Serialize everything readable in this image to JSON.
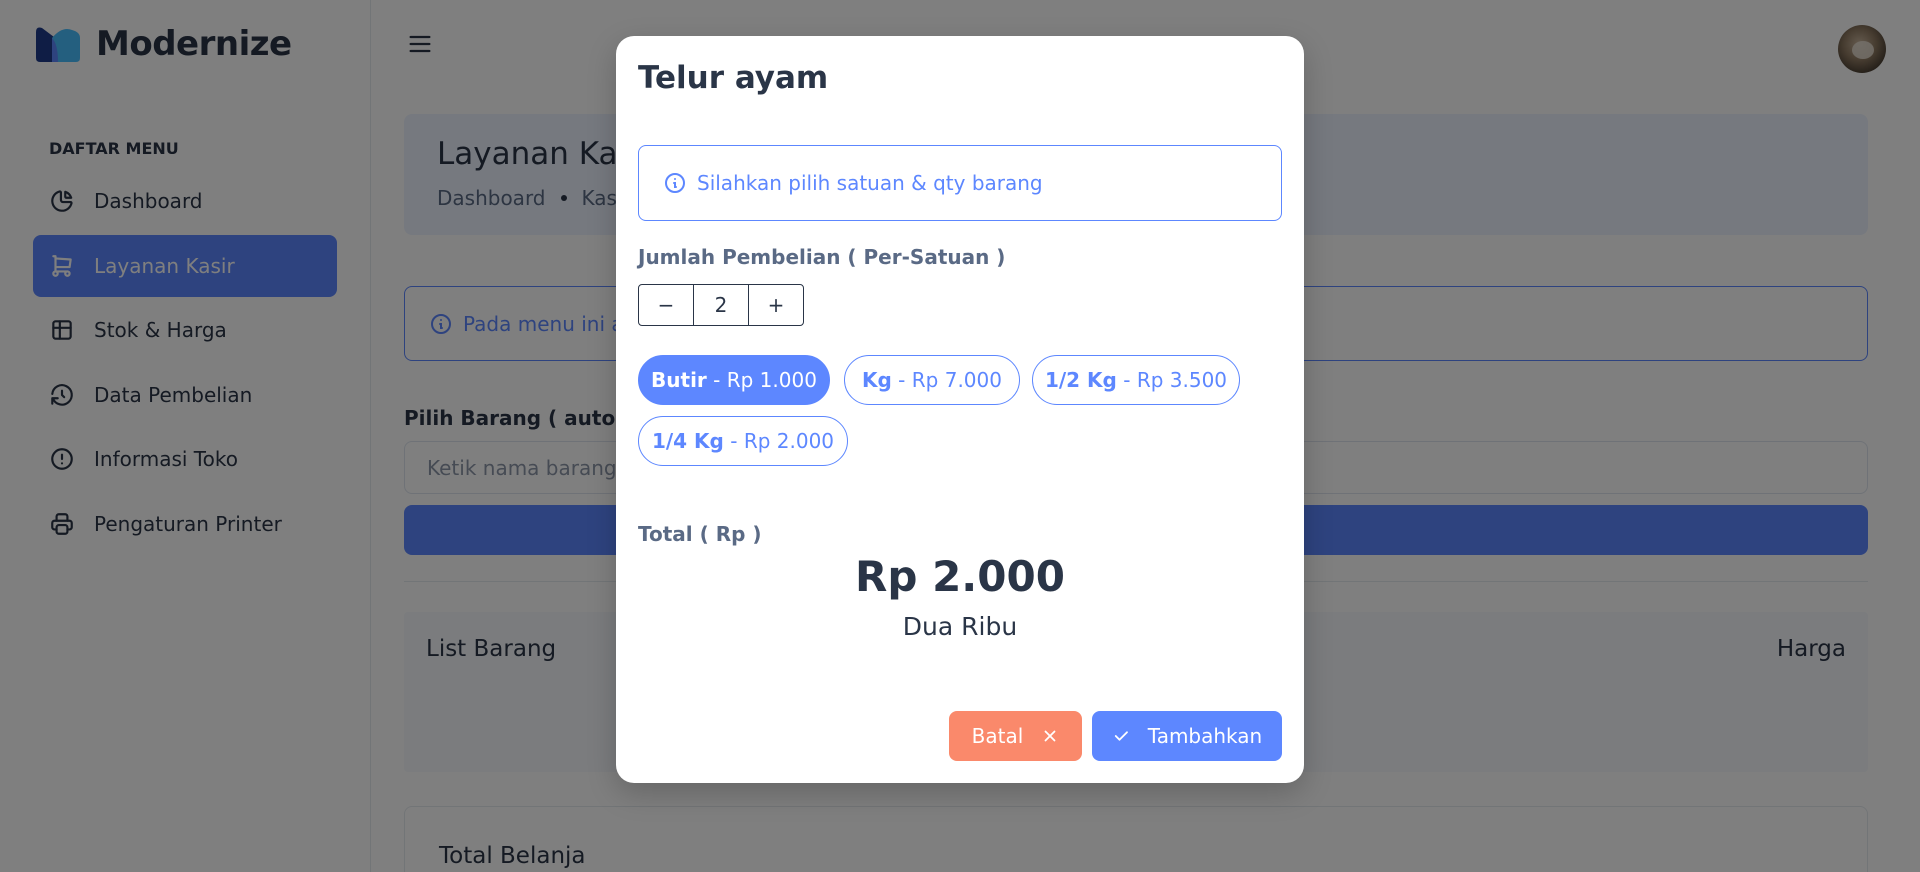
{
  "brand": {
    "name": "Modernize"
  },
  "sidebar": {
    "heading": "DAFTAR MENU",
    "items": [
      {
        "label": "Dashboard",
        "icon": "pie-chart-icon",
        "active": false
      },
      {
        "label": "Layanan Kasir",
        "icon": "shopping-cart-icon",
        "active": true
      },
      {
        "label": "Stok & Harga",
        "icon": "table-icon",
        "active": false
      },
      {
        "label": "Data Pembelian",
        "icon": "history-icon",
        "active": false
      },
      {
        "label": "Informasi Toko",
        "icon": "alert-circle-icon",
        "active": false
      },
      {
        "label": "Pengaturan Printer",
        "icon": "printer-icon",
        "active": false
      }
    ]
  },
  "header": {
    "menu_icon": "hamburger-icon",
    "avatar": "user-avatar"
  },
  "main": {
    "page_title": "Layanan Kasir",
    "breadcrumb": [
      "Dashboard",
      "Kasir"
    ],
    "info_text": "Pada menu ini anda dapat melakukan transaksi penjualan barang",
    "pilih_label": "Pilih Barang ( autocomplete )",
    "search_placeholder": "Ketik nama barang..",
    "table_headers": {
      "list": "List Barang",
      "harga": "Harga"
    },
    "total_title": "Total Belanja"
  },
  "modal": {
    "title": "Telur ayam",
    "alert_text": "Silahkan pilih satuan & qty barang",
    "qty_label": "Jumlah Pembelian ( Per-Satuan )",
    "qty_minus": "−",
    "qty_value": "2",
    "qty_plus": "+",
    "units": [
      {
        "unit": "Butir",
        "sep": " - ",
        "price": "Rp 1.000",
        "selected": true
      },
      {
        "unit": "Kg",
        "sep": " - ",
        "price": "Rp 7.000",
        "selected": false
      },
      {
        "unit": "1/2 Kg",
        "sep": " - ",
        "price": "Rp 3.500",
        "selected": false
      },
      {
        "unit": "1/4 Kg",
        "sep": " - ",
        "price": "Rp 2.000",
        "selected": false
      }
    ],
    "total_label": "Total ( Rp )",
    "total_value": "Rp 2.000",
    "total_words": "Dua Ribu",
    "cancel_label": "Batal",
    "add_label": "Tambahkan"
  },
  "colors": {
    "primary": "#5d87ff",
    "danger": "#fa896b",
    "text": "#2a3547",
    "light_primary": "#ecf2ff"
  }
}
